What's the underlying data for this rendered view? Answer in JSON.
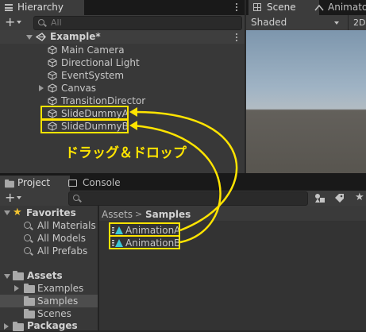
{
  "hierarchy": {
    "tab_label": "Hierarchy",
    "search_placeholder": "All",
    "scene_name": "Example*",
    "items": [
      {
        "label": "Main Camera"
      },
      {
        "label": "Directional Light"
      },
      {
        "label": "EventSystem"
      },
      {
        "label": "Canvas"
      },
      {
        "label": "TransitionDirector"
      },
      {
        "label": "SlideDummyA"
      },
      {
        "label": "SlideDummyB"
      }
    ]
  },
  "scene": {
    "tab_scene": "Scene",
    "tab_animator": "Animato",
    "shading_mode": "Shaded",
    "mode_2d": "2D"
  },
  "annotation": {
    "text": "ドラッグ＆ドロップ",
    "color": "#ffe400"
  },
  "project": {
    "tab_project": "Project",
    "tab_console": "Console",
    "favorites_label": "Favorites",
    "favorites": [
      {
        "label": "All Materials"
      },
      {
        "label": "All Models"
      },
      {
        "label": "All Prefabs"
      }
    ],
    "assets_label": "Assets",
    "asset_folders": [
      {
        "label": "Examples"
      },
      {
        "label": "Samples"
      },
      {
        "label": "Scenes"
      }
    ],
    "packages_label": "Packages",
    "breadcrumb_root": "Assets",
    "breadcrumb_sep": ">",
    "breadcrumb_current": "Samples",
    "files": [
      {
        "label": "AnimationA"
      },
      {
        "label": "AnimationB"
      }
    ]
  }
}
